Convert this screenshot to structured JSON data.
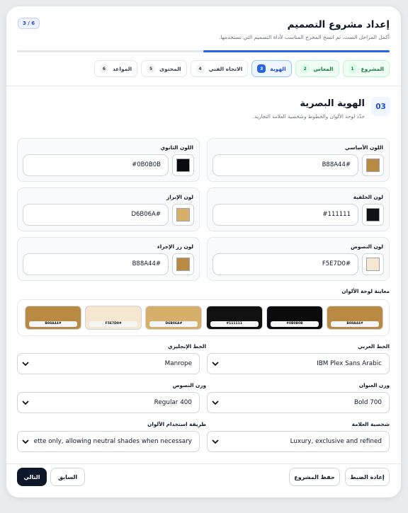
{
  "header": {
    "title": "إعداد مشروع التصميم",
    "subtitle": "أكمل المراحل الست، ثم انسخ المخرج المناسب لأداة التصميم التي تستخدمها.",
    "step_counter": "3 / 6",
    "progress_fraction": 0.5,
    "accent_color": "#2563eb"
  },
  "tabs": [
    {
      "num": "1",
      "label": "المشروع",
      "state": "done"
    },
    {
      "num": "2",
      "label": "المعاس",
      "state": "done"
    },
    {
      "num": "3",
      "label": "الهوية",
      "state": "active"
    },
    {
      "num": "4",
      "label": "الاتجاه الفني",
      "state": "pending"
    },
    {
      "num": "5",
      "label": "المحتوى",
      "state": "pending"
    },
    {
      "num": "6",
      "label": "المواعد",
      "state": "pending"
    }
  ],
  "section": {
    "badge": "03",
    "title": "الهوية البصرية",
    "subtitle": "حدّد لوحة الألوان والخطوط وشخصية العلامة التجارية."
  },
  "colors": {
    "primary": {
      "label": "اللون الأساسي",
      "value": "B88A44#",
      "hex": "#B88A44"
    },
    "secondary": {
      "label": "اللون الثانوي",
      "value": "#0B0B0B",
      "hex": "#0B0B0B"
    },
    "background": {
      "label": "لون الخلفية",
      "value": "#111111",
      "hex": "#111111"
    },
    "highlight": {
      "label": "لون الإبراز",
      "value": "D6B06A#",
      "hex": "#D6B06A"
    },
    "text": {
      "label": "لون النصوص",
      "value": "F5E7D0#",
      "hex": "#F5E7D0"
    },
    "cta": {
      "label": "لون زر الإجراء",
      "value": "B88A44#",
      "hex": "#B88A44"
    }
  },
  "palette_preview": {
    "label": "معاينة لوحة الألوان",
    "swatches": [
      {
        "code": "B88A44#",
        "hex": "#B88A44"
      },
      {
        "code": "#0B0B0B",
        "hex": "#0B0B0B"
      },
      {
        "code": "#111111",
        "hex": "#111111"
      },
      {
        "code": "D6B06A#",
        "hex": "#D6B06A"
      },
      {
        "code": "F5E7D0#",
        "hex": "#F5E7D0"
      },
      {
        "code": "B88A44#",
        "hex": "#B88A44"
      }
    ]
  },
  "fonts": {
    "arabic": {
      "label": "الخط العربي",
      "value": "IBM Plex Sans Arabic"
    },
    "english": {
      "label": "الخط الإنجليزي",
      "value": "Manrope"
    },
    "heading_weight": {
      "label": "وزن العنوان",
      "value": "Bold 700"
    },
    "body_weight": {
      "label": "وزن النصوص",
      "value": "Regular 400"
    },
    "brand_personality": {
      "label": "شخصية العلامة",
      "value": "Luxury, exclusive and refined"
    },
    "color_usage": {
      "label": "طريقة استخدام الألوان",
      "value": "palette only, allowing neutral shades when necessary"
    }
  },
  "footer": {
    "reset": "إعادة الضبط",
    "save": "حفظ المشروع",
    "previous": "السابق",
    "next": "التالي"
  }
}
